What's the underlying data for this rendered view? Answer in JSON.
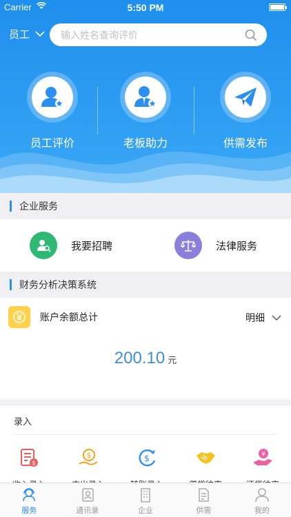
{
  "status_bar": {
    "carrier": "Carrier",
    "time": "5:50 PM"
  },
  "header": {
    "role": "员工",
    "search_placeholder": "输入姓名查询评价",
    "features": [
      {
        "label": "员工评价",
        "icon": "employee-icon"
      },
      {
        "label": "老板助力",
        "icon": "boss-icon"
      },
      {
        "label": "供需发布",
        "icon": "paper-plane-icon"
      }
    ]
  },
  "enterprise_services": {
    "title": "企业服务",
    "items": [
      {
        "label": "我要招聘",
        "icon": "recruit-icon",
        "color": "#2fb873"
      },
      {
        "label": "法律服务",
        "icon": "scales-icon",
        "color": "#8b7fdc"
      }
    ]
  },
  "finance": {
    "title": "财务分析决策系统",
    "account_label": "账户余额总计",
    "detail_label": "明细",
    "amount": "200.10",
    "unit": "元"
  },
  "entry": {
    "title": "录入",
    "items": [
      {
        "label": "收入录入",
        "icon": "income-record-icon",
        "color": "#f25b5b"
      },
      {
        "label": "支出录入",
        "icon": "expense-record-icon",
        "color": "#f2a21a"
      },
      {
        "label": "转账录入",
        "icon": "transfer-icon",
        "color": "#2a8ff0"
      },
      {
        "label": "借贷往来",
        "icon": "handshake-icon",
        "color": "#f5c21f"
      },
      {
        "label": "还贷往来",
        "icon": "repay-icon",
        "color": "#ee5fa6"
      }
    ]
  },
  "tabbar": {
    "items": [
      {
        "label": "服务",
        "icon": "service-icon",
        "active": true
      },
      {
        "label": "通讯录",
        "icon": "contacts-icon",
        "active": false
      },
      {
        "label": "企业",
        "icon": "building-icon",
        "active": false
      },
      {
        "label": "供需",
        "icon": "document-icon",
        "active": false
      },
      {
        "label": "我的",
        "icon": "user-icon",
        "active": false
      }
    ]
  },
  "colors": {
    "accent": "#2a8ff0",
    "header_top": "#1f8fee",
    "amount": "#3b8ee0"
  }
}
